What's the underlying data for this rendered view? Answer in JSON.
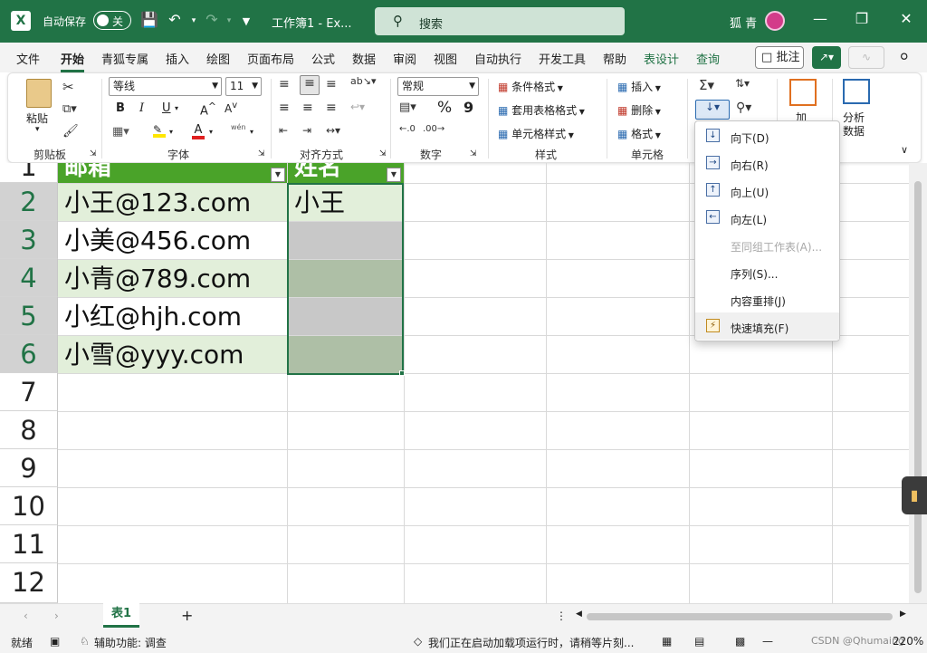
{
  "titlebar": {
    "app_icon": "excel-logo",
    "autosave_label": "自动保存",
    "autosave_state": "关",
    "doc_title": "工作簿1 - Ex...",
    "search_placeholder": "搜索",
    "user_name": "狐 青",
    "window_controls": [
      "minimize",
      "restore",
      "close"
    ]
  },
  "menu": {
    "tabs": [
      "文件",
      "开始",
      "青狐专属",
      "插入",
      "绘图",
      "页面布局",
      "公式",
      "数据",
      "审阅",
      "视图",
      "自动执行",
      "开发工具",
      "帮助",
      "表设计",
      "查询"
    ],
    "active_tab": "开始",
    "comment_button": "批注"
  },
  "ribbon": {
    "clipboard": {
      "paste": "粘贴",
      "label": "剪贴板"
    },
    "font": {
      "name": "等线",
      "size": "11",
      "label": "字体",
      "phonetic": "wén"
    },
    "alignment": {
      "label": "对齐方式"
    },
    "number": {
      "format": "常规",
      "label": "数字",
      "percent": "%",
      "comma": "9"
    },
    "styles": {
      "conditional": "条件格式",
      "table_format": "套用表格格式",
      "cell_style": "单元格样式",
      "label": "样式"
    },
    "cells": {
      "insert": "插入",
      "delete": "删除",
      "format": "格式",
      "label": "单元格"
    },
    "editing": {
      "add_label": "加",
      "analyze_line1": "分析",
      "analyze_line2": "数据"
    }
  },
  "fill_menu": {
    "items": [
      {
        "label": "向下(D)",
        "icon": "arrow-down-icon",
        "disabled": false
      },
      {
        "label": "向右(R)",
        "icon": "arrow-right-icon",
        "disabled": false
      },
      {
        "label": "向上(U)",
        "icon": "arrow-up-icon",
        "disabled": false
      },
      {
        "label": "向左(L)",
        "icon": "arrow-left-icon",
        "disabled": false
      },
      {
        "label": "至同组工作表(A)...",
        "icon": "",
        "disabled": true
      },
      {
        "label": "序列(S)...",
        "icon": "",
        "disabled": false
      },
      {
        "label": "内容重排(J)",
        "icon": "",
        "disabled": false
      },
      {
        "label": "快速填充(F)",
        "icon": "flash-fill-icon",
        "disabled": false
      }
    ]
  },
  "sheet": {
    "row_numbers": [
      "1",
      "2",
      "3",
      "4",
      "5",
      "6",
      "7",
      "8",
      "9",
      "10",
      "11",
      "12"
    ],
    "headers": [
      "邮箱",
      "姓名"
    ],
    "rows": [
      [
        "小王@123.com",
        "小王"
      ],
      [
        "小美@456.com",
        ""
      ],
      [
        "小青@789.com",
        ""
      ],
      [
        "小红@hjh.com",
        ""
      ],
      [
        "小雪@yyy.com",
        ""
      ]
    ]
  },
  "tabs_bar": {
    "sheet_name": "表1",
    "add": "+"
  },
  "status": {
    "ready": "就绪",
    "accessibility": "辅助功能: 调查",
    "message": "我们正在启动加载项运行时，请稍等片刻...",
    "zoom": "220%",
    "watermark": "CSDN @Qhumaing"
  },
  "colors": {
    "excel_green": "#217346",
    "table_header": "#4aa329",
    "table_band": "#e2efda"
  }
}
